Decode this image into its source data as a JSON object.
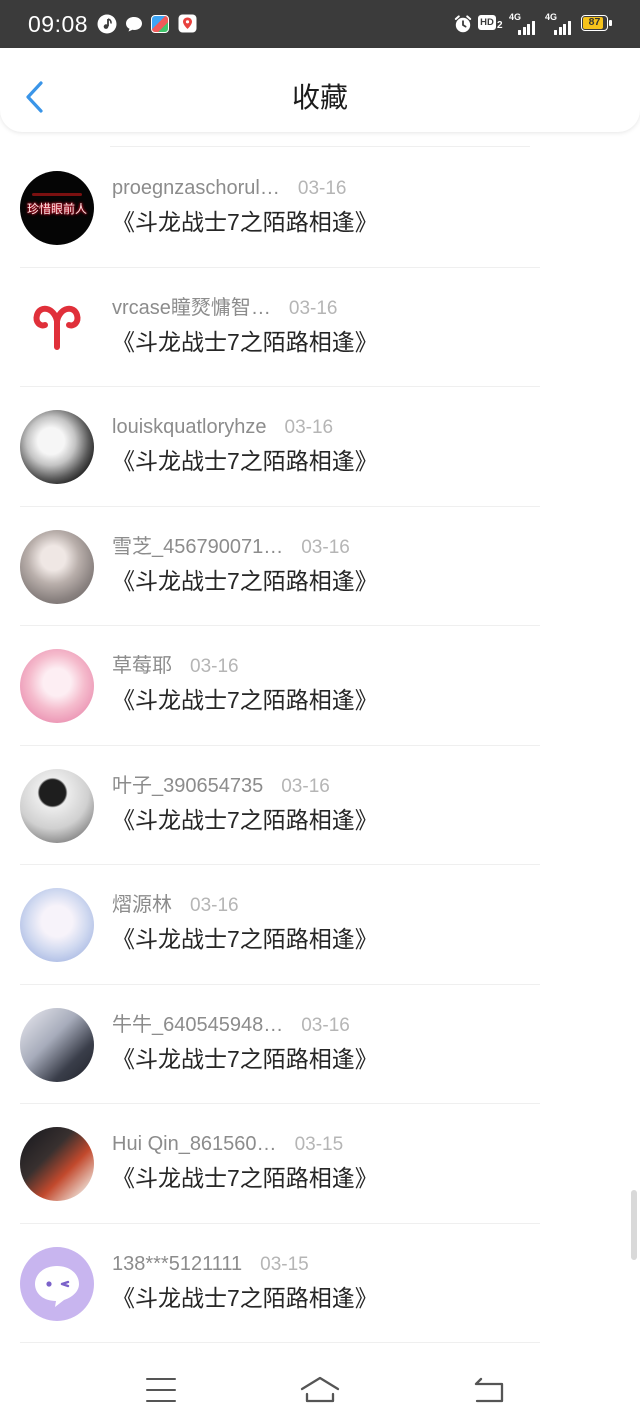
{
  "status_bar": {
    "time": "09:08",
    "notification_icons": [
      "music-icon",
      "chat-bubble-icon",
      "app-icon",
      "location-pin-icon"
    ],
    "hd_label": "HD",
    "hd_sub": "2",
    "sim1_network": "4G",
    "sim2_network": "4G",
    "battery_percent": "87"
  },
  "header": {
    "title": "收藏",
    "back_icon": "chevron-left-icon"
  },
  "favorites": [
    {
      "user": "proegnzaschorul…",
      "date": "03-16",
      "title": "《斗龙战士7之陌路相逢》",
      "avatar_text": "珍惜眼前人"
    },
    {
      "user": "vrcase瞳燹慵智…",
      "date": "03-16",
      "title": "《斗龙战士7之陌路相逢》"
    },
    {
      "user": "louiskquatloryhze",
      "date": "03-16",
      "title": "《斗龙战士7之陌路相逢》"
    },
    {
      "user": "雪芝_456790071…",
      "date": "03-16",
      "title": "《斗龙战士7之陌路相逢》"
    },
    {
      "user": "草莓耶",
      "date": "03-16",
      "title": "《斗龙战士7之陌路相逢》"
    },
    {
      "user": "叶子_390654735",
      "date": "03-16",
      "title": "《斗龙战士7之陌路相逢》"
    },
    {
      "user": "熠源林",
      "date": "03-16",
      "title": "《斗龙战士7之陌路相逢》"
    },
    {
      "user": "牛牛_640545948…",
      "date": "03-16",
      "title": "《斗龙战士7之陌路相逢》"
    },
    {
      "user": "Hui Qin_861560…",
      "date": "03-15",
      "title": "《斗龙战士7之陌路相逢》"
    },
    {
      "user": "138***5121111",
      "date": "03-15",
      "title": "《斗龙战士7之陌路相逢》"
    }
  ],
  "nav_bar": {
    "icons": [
      "menu-icon",
      "home-icon",
      "back-icon"
    ]
  },
  "colors": {
    "status_bar_bg": "#3b3b3b",
    "accent": "#3a95e8",
    "username": "#8c8c8c",
    "date": "#b5b5b5",
    "title_text": "#262626",
    "battery_fill": "#f5c21b"
  }
}
